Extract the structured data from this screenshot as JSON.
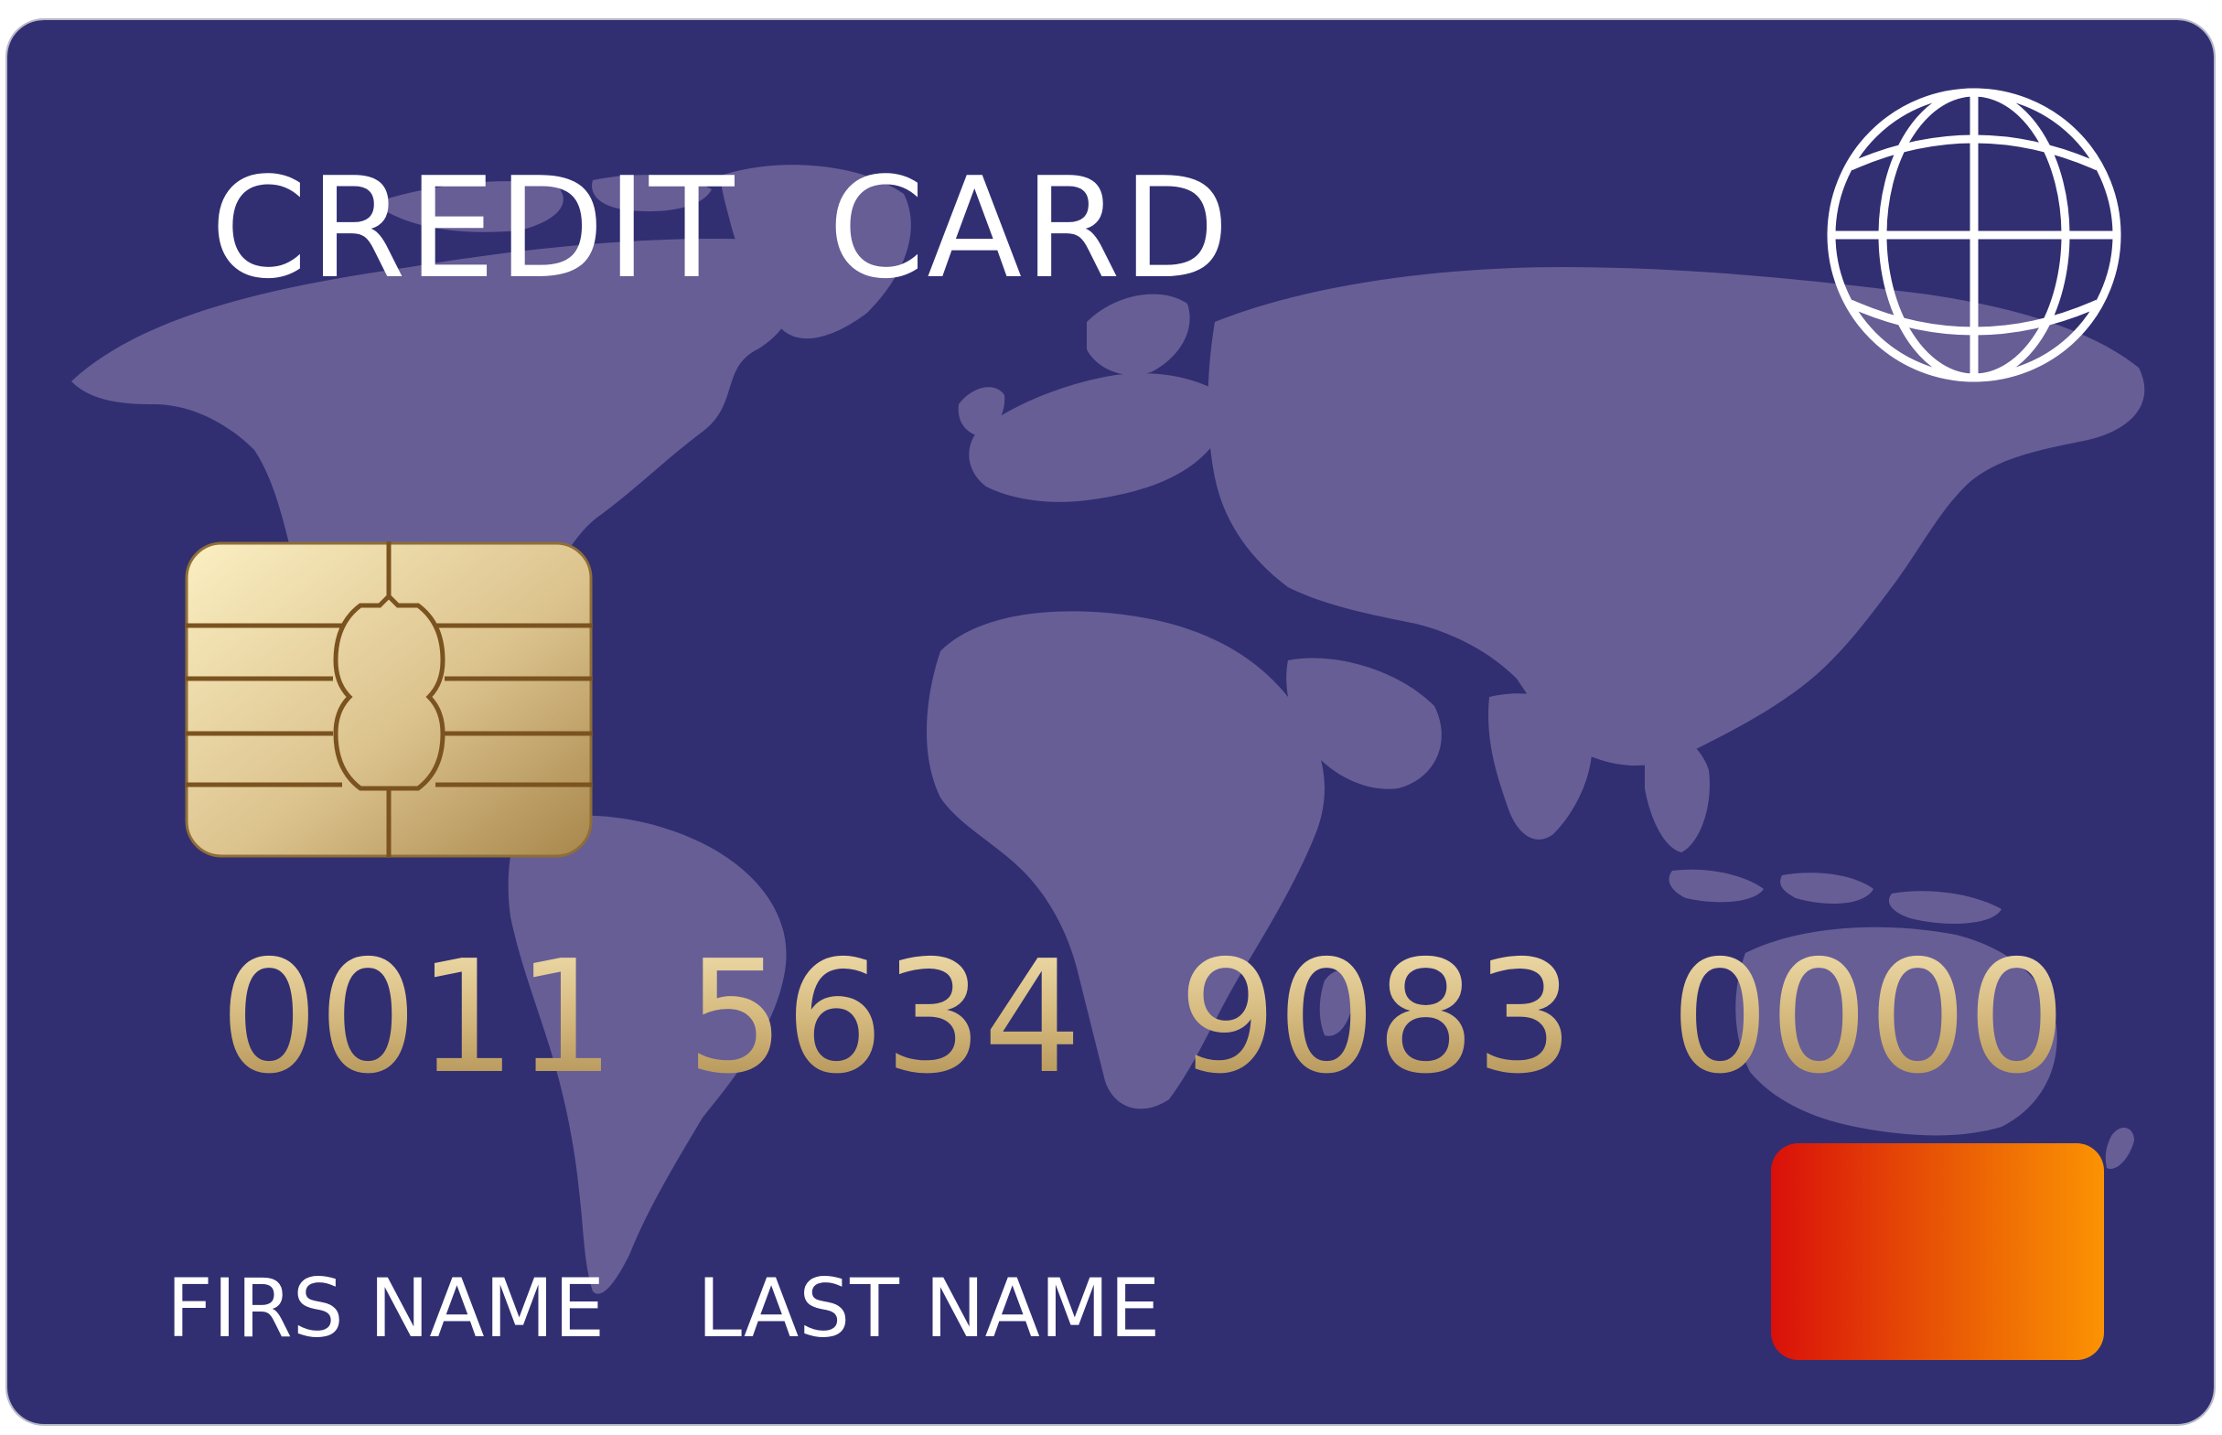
{
  "card": {
    "title": "CREDIT  CARD",
    "number_groups": [
      "0011",
      "5634",
      "9083",
      "0000"
    ],
    "first_name": "FIRS NAME",
    "last_name": "LAST NAME"
  },
  "icons": {
    "globe": "globe-icon",
    "chip": "emv-chip",
    "world_map": "world-map",
    "brand_logo": "brand-logo"
  },
  "colors": {
    "card_background": "#312f72",
    "map_land": "#675e96",
    "title_text": "#ffffff",
    "number_gold_light": "#efdcab",
    "number_gold_dark": "#b08f52",
    "chip_gold_light": "#fbefc2",
    "chip_gold_dark": "#a8874b",
    "brand_red": "#d9100a",
    "brand_orange": "#fb9303"
  }
}
